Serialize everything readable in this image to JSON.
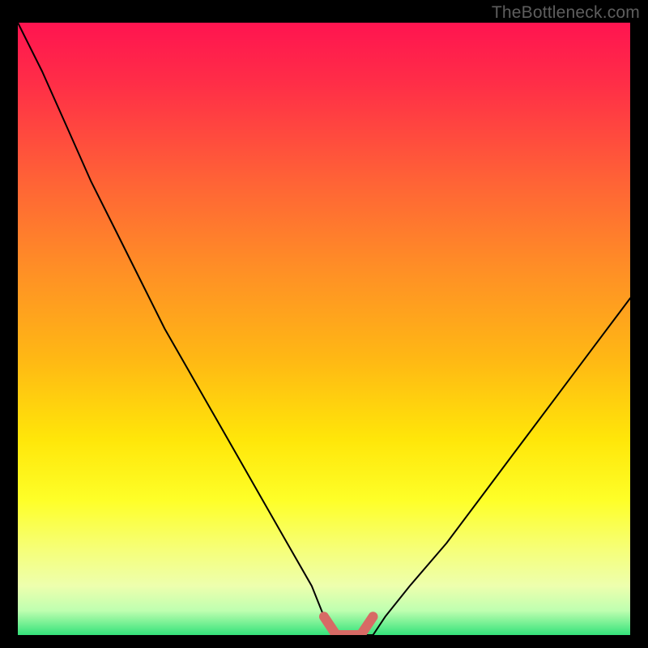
{
  "watermark": "TheBottleneck.com",
  "chart_data": {
    "type": "line",
    "title": "",
    "xlabel": "",
    "ylabel": "",
    "xlim": [
      0,
      100
    ],
    "ylim": [
      0,
      100
    ],
    "series": [
      {
        "name": "bottleneck-curve",
        "x": [
          0,
          4,
          8,
          12,
          16,
          20,
          24,
          28,
          32,
          36,
          40,
          44,
          48,
          50,
          52,
          54,
          56,
          58,
          60,
          64,
          70,
          76,
          82,
          88,
          94,
          100
        ],
        "y": [
          100,
          92,
          83,
          74,
          66,
          58,
          50,
          43,
          36,
          29,
          22,
          15,
          8,
          3,
          0,
          0,
          0,
          0,
          3,
          8,
          15,
          23,
          31,
          39,
          47,
          55
        ]
      }
    ],
    "highlight": {
      "name": "fit-range-marker",
      "x": [
        50,
        52,
        54,
        56,
        58
      ],
      "y": [
        3,
        0,
        0,
        0,
        3
      ],
      "color": "#d76a65"
    },
    "gradient_stops": [
      {
        "pos": 0,
        "color": "#ff1450"
      },
      {
        "pos": 10,
        "color": "#ff2e47"
      },
      {
        "pos": 26,
        "color": "#ff6336"
      },
      {
        "pos": 40,
        "color": "#ff8e26"
      },
      {
        "pos": 55,
        "color": "#ffb814"
      },
      {
        "pos": 68,
        "color": "#ffe609"
      },
      {
        "pos": 78,
        "color": "#feff28"
      },
      {
        "pos": 86,
        "color": "#f6ff78"
      },
      {
        "pos": 92,
        "color": "#edffae"
      },
      {
        "pos": 96,
        "color": "#bfffb0"
      },
      {
        "pos": 100,
        "color": "#34e27a"
      }
    ]
  }
}
